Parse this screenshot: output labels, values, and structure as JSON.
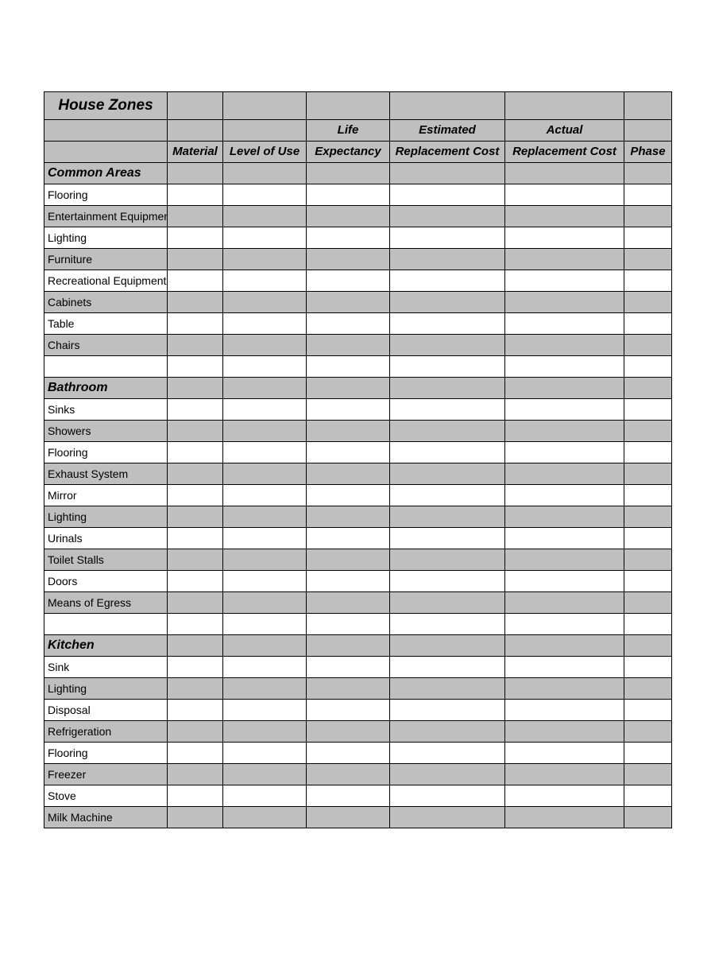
{
  "title": "House Zones",
  "headers": {
    "row1": [
      "",
      "",
      "",
      "Life",
      "Estimated",
      "Actual",
      ""
    ],
    "row2": [
      "",
      "Material",
      "Level of Use",
      "Expectancy",
      "Replacement Cost",
      "Replacement Cost",
      "Phase"
    ]
  },
  "sections": [
    {
      "name": "Common Areas",
      "items": [
        "Flooring",
        "Entertainment Equipment",
        "Lighting",
        "Furniture",
        "Recreational Equipment",
        "Cabinets",
        "Table",
        "Chairs"
      ]
    },
    {
      "name": "Bathroom",
      "items": [
        "Sinks",
        "Showers",
        "Flooring",
        "Exhaust System",
        "Mirror",
        "Lighting",
        "Urinals",
        "Toilet Stalls",
        "Doors",
        "Means of Egress"
      ]
    },
    {
      "name": "Kitchen",
      "items": [
        "Sink",
        "Lighting",
        "Disposal",
        "Refrigeration",
        "Flooring",
        "Freezer",
        "Stove",
        "Milk Machine"
      ]
    }
  ]
}
